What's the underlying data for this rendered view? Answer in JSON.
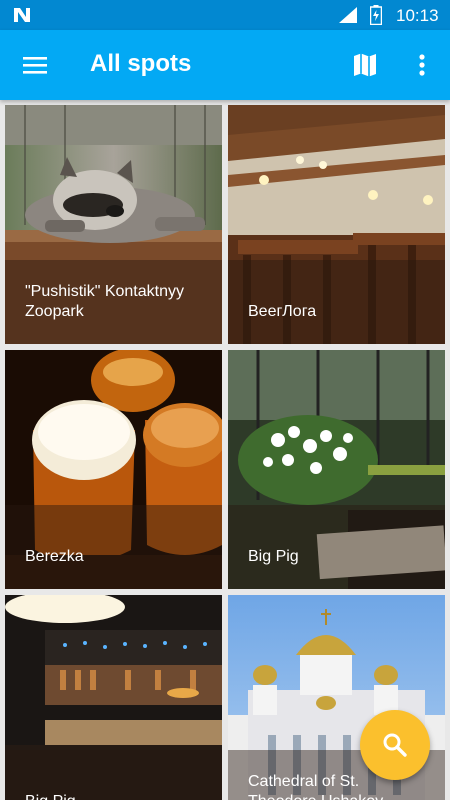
{
  "status_bar": {
    "time": "10:13",
    "icons": [
      "notification-n-icon",
      "signal-icon",
      "battery-icon"
    ]
  },
  "app_bar": {
    "title": "All spots",
    "icons": [
      "menu-icon",
      "map-icon",
      "more-vert-icon"
    ]
  },
  "spots": [
    {
      "name": "\"Pushistik\" Kontaktnyy Zoopark"
    },
    {
      "name": "ВеегЛога"
    },
    {
      "name": "Berezka"
    },
    {
      "name": "Big Pig"
    },
    {
      "name": "Big Pig"
    },
    {
      "name": "Cathedral of St. Theodore Ushakov"
    }
  ],
  "fab": {
    "icon": "search-icon"
  },
  "colors": {
    "status_bar": "#0288d1",
    "app_bar": "#03a9f4",
    "fab": "#fbc02d"
  }
}
